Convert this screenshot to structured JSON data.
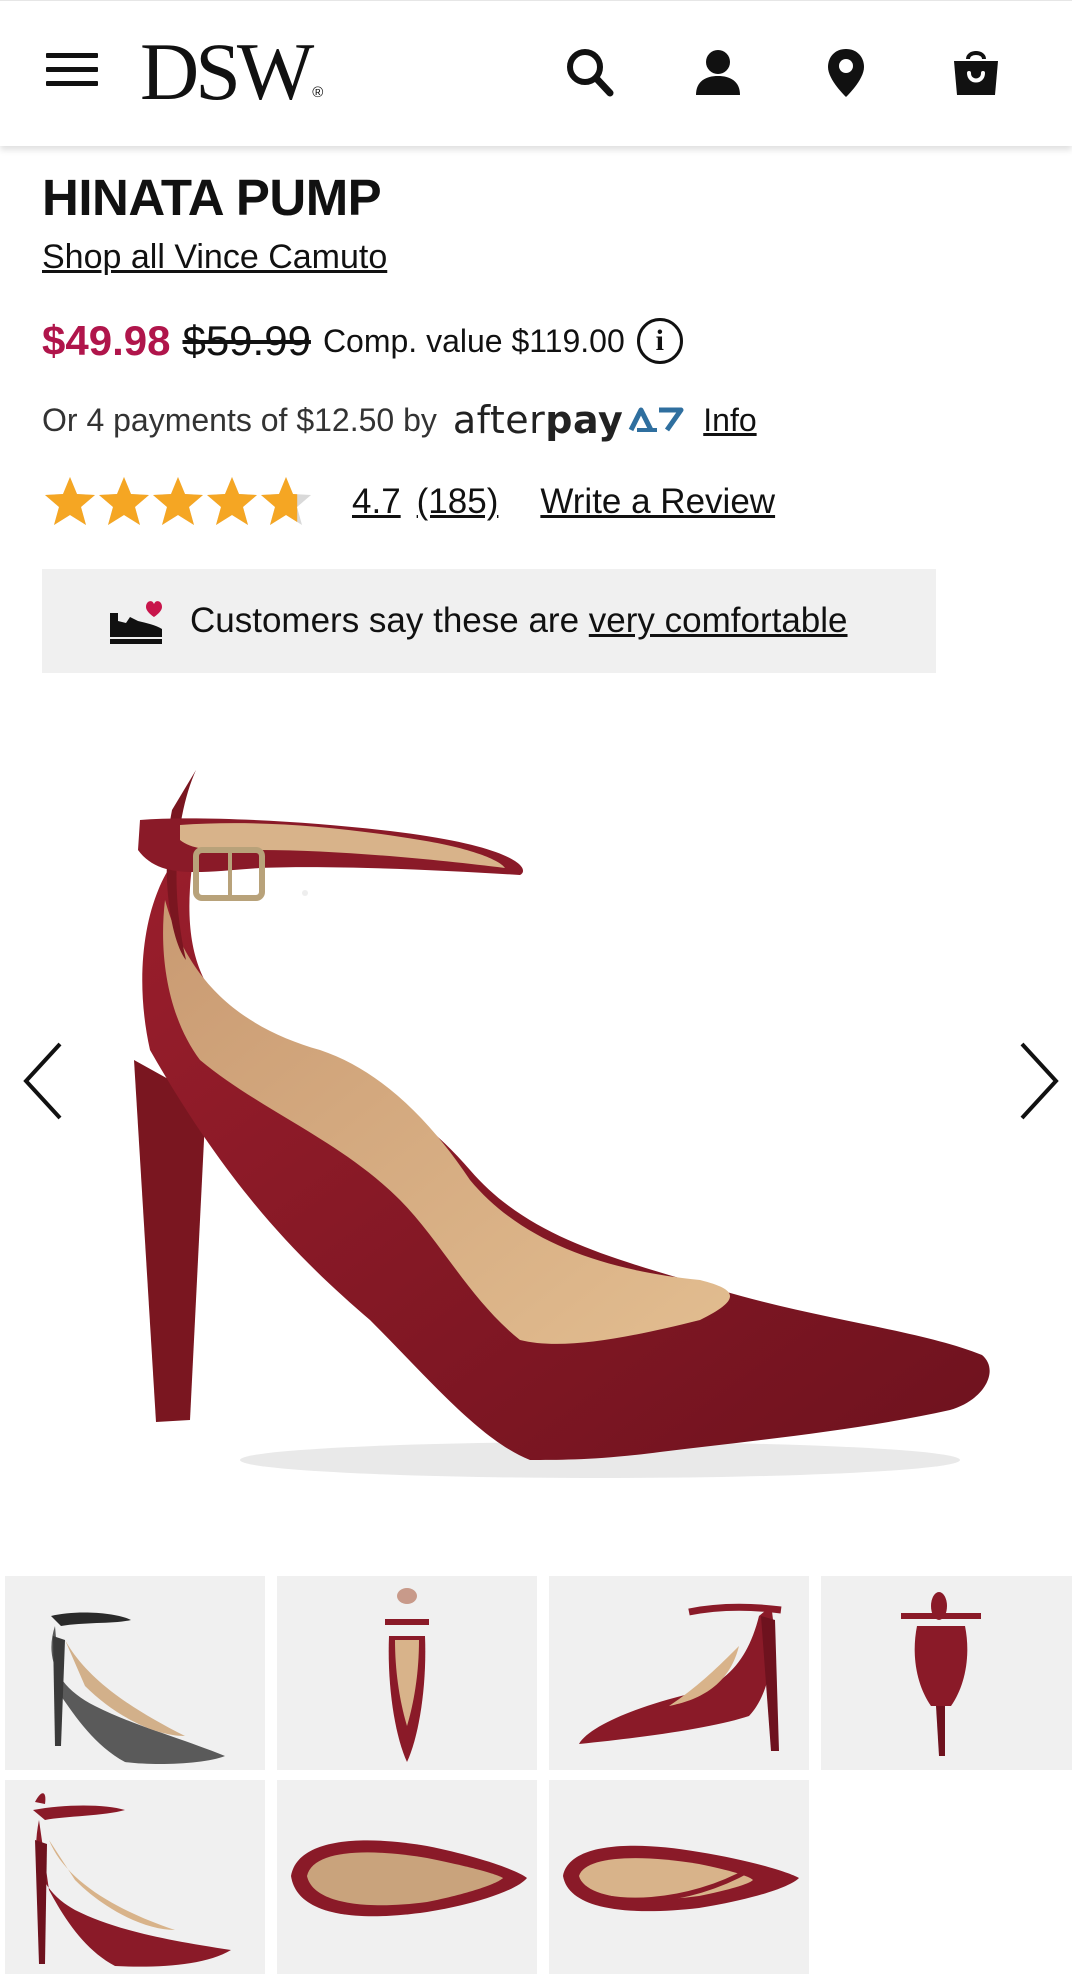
{
  "header": {
    "logo_text": "DSW",
    "logo_mark": "®",
    "icons": [
      "menu-icon",
      "search-icon",
      "account-icon",
      "store-locator-icon",
      "shopping-bag-icon"
    ]
  },
  "product": {
    "title": "HINATA PUMP",
    "brand_link": "Shop all Vince Camuto",
    "price_sale": "$49.98",
    "price_original": "$59.99",
    "comp_value": "Comp. value $119.00",
    "info_glyph": "i",
    "afterpay_text": "Or 4 payments of $12.50 by",
    "afterpay_logo_light": "after",
    "afterpay_logo_bold": "pay",
    "afterpay_info": "Info",
    "rating_stars": 4.7,
    "rating_value": "4.7",
    "review_count": "(185)",
    "write_review": "Write a Review",
    "comfort_text": "Customers say these are",
    "comfort_link": "very comfortable"
  },
  "gallery": {
    "thumbnails": [
      {
        "name": "thumb-black-side",
        "color": "#4a4a4a"
      },
      {
        "name": "thumb-red-front",
        "color": "#8a1a28"
      },
      {
        "name": "thumb-red-side-angle",
        "color": "#8a1a28"
      },
      {
        "name": "thumb-red-back",
        "color": "#8a1a28"
      },
      {
        "name": "thumb-red-side",
        "color": "#8a1a28"
      },
      {
        "name": "thumb-red-sole",
        "color": "#8a1a28"
      },
      {
        "name": "thumb-red-top",
        "color": "#8a1a28"
      }
    ]
  },
  "colors": {
    "sale_price": "#b0154b",
    "star": "#f5a623",
    "shoe": "#8a1a28",
    "lining": "#d8b38a",
    "comfort_bg": "#f0f0f0"
  }
}
